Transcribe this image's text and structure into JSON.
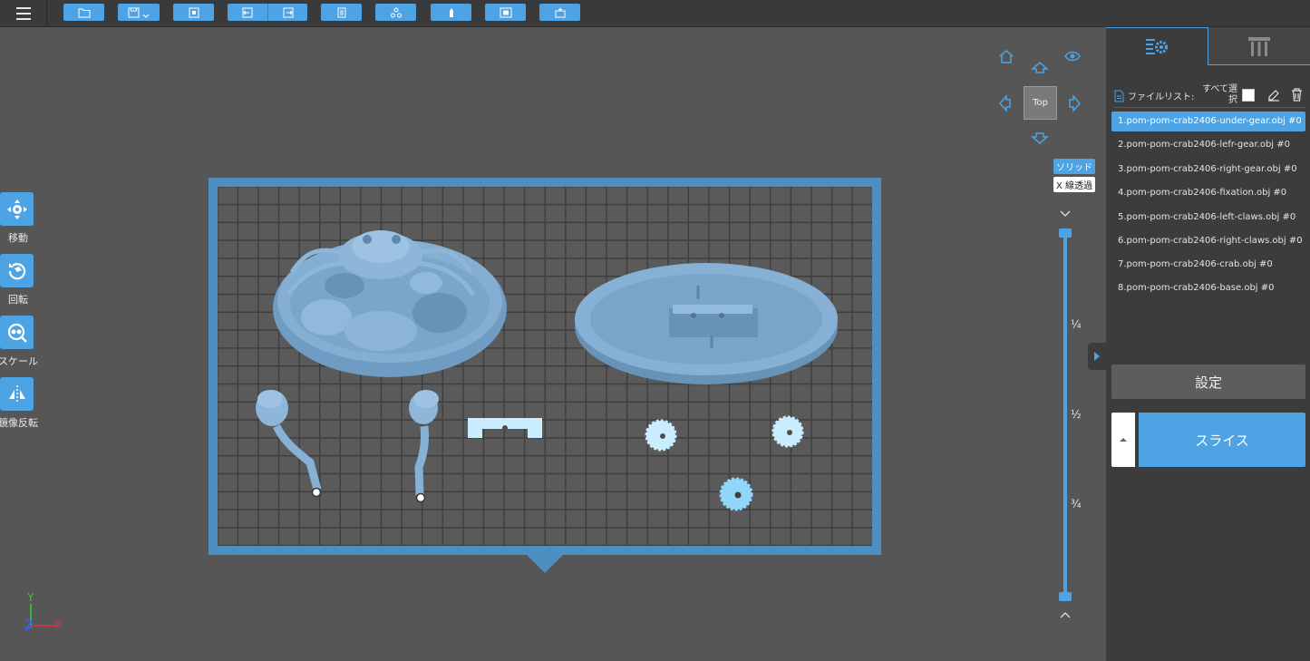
{
  "toolbar": {
    "icons": [
      "folder-icon",
      "save-icon",
      "fit-icon",
      "import-icon",
      "export-icon",
      "list-icon",
      "group-icon",
      "support-icon",
      "frame-icon",
      "add-icon"
    ]
  },
  "tools": [
    {
      "label": "移動",
      "icon": "move-icon"
    },
    {
      "label": "回転",
      "icon": "rotate-icon"
    },
    {
      "label": "スケール",
      "icon": "scale-icon"
    },
    {
      "label": "鏡像反転",
      "icon": "mirror-icon"
    }
  ],
  "view": {
    "current": "Top",
    "mode_solid": "ソリッド",
    "mode_xray": "X 線透過"
  },
  "slider": {
    "quarter": "¼",
    "half": "½",
    "three_quarter": "¾"
  },
  "axis": {
    "y": "Y",
    "z": "Z",
    "x": "X"
  },
  "panel": {
    "filelist_title": "ファイルリスト:",
    "select_all": "すべて選択",
    "files": [
      "1.pom-pom-crab2406-under-gear.obj #0",
      "2.pom-pom-crab2406-lefr-gear.obj #0",
      "3.pom-pom-crab2406-right-gear.obj #0",
      "4.pom-pom-crab2406-fixation.obj #0",
      "5.pom-pom-crab2406-left-claws.obj #0",
      "6.pom-pom-crab2406-right-claws.obj #0",
      "7.pom-pom-crab2406-crab.obj #0",
      "8.pom-pom-crab2406-base.obj #0"
    ],
    "selected_index": 0,
    "settings_label": "設定",
    "slice_label": "スライス"
  },
  "colors": {
    "accent": "#4da3e3",
    "model": "#7fa9cc",
    "part": "#c9ecff"
  }
}
